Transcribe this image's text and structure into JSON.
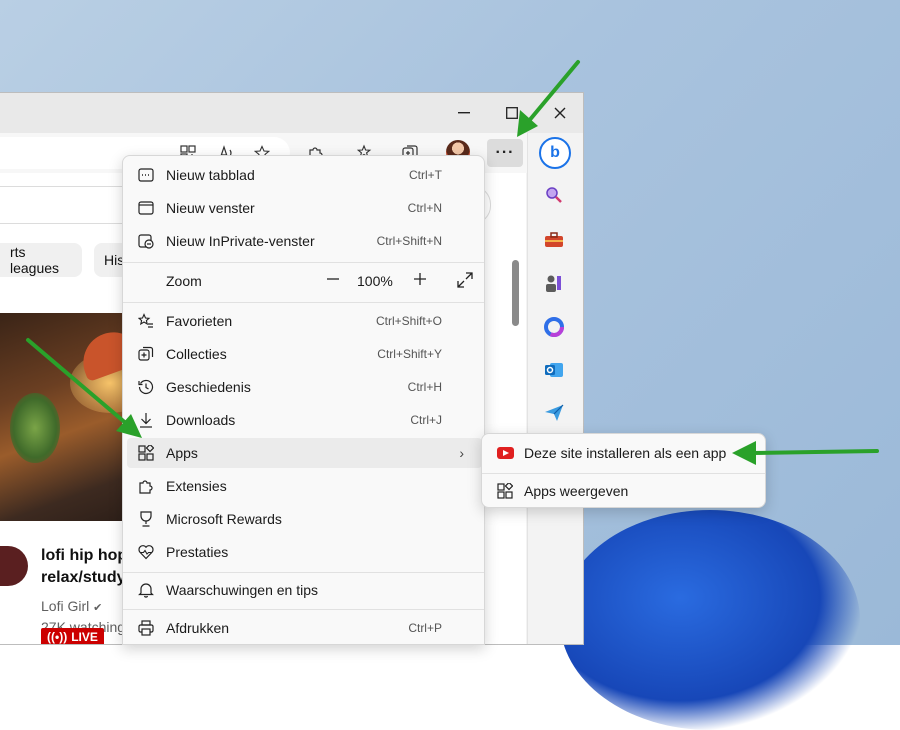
{
  "colors": {
    "accent_green": "#2aa12a",
    "live_red": "#cc0000",
    "menu_bg": "#f9f9f9",
    "highlight": "#ebebeb"
  },
  "window": {
    "controls": {
      "maximize": "☐",
      "close": "✕"
    }
  },
  "toolbar": {
    "more_label": "···",
    "icons": [
      "grid-icon",
      "read-aloud-icon",
      "favorite-star-icon",
      "extensions-icon",
      "favorites-list-icon",
      "collections-icon"
    ]
  },
  "page": {
    "chips": [
      "rts leagues",
      "His"
    ],
    "video": {
      "title": "lofi hip hop relax/study",
      "channel": "Lofi Girl",
      "verified": "✔",
      "watching": "27K watching",
      "live": "LIVE"
    }
  },
  "sidebar": {
    "icons": [
      "bing-icon",
      "search-icon",
      "toolbox-icon",
      "games-icon",
      "microsoft365-icon",
      "outlook-icon",
      "send-icon"
    ]
  },
  "menu": {
    "items": [
      {
        "label": "Nieuw tabblad",
        "shortcut": "Ctrl+T",
        "icon": "new-tab-icon"
      },
      {
        "label": "Nieuw venster",
        "shortcut": "Ctrl+N",
        "icon": "new-window-icon"
      },
      {
        "label": "Nieuw InPrivate-venster",
        "shortcut": "Ctrl+Shift+N",
        "icon": "inprivate-icon"
      }
    ],
    "zoom": {
      "label": "Zoom",
      "minus": "—",
      "value": "100%",
      "plus": "+",
      "expand": "⤢"
    },
    "items2": [
      {
        "label": "Favorieten",
        "shortcut": "Ctrl+Shift+O",
        "icon": "favorites-icon"
      },
      {
        "label": "Collecties",
        "shortcut": "Ctrl+Shift+Y",
        "icon": "collections-icon"
      },
      {
        "label": "Geschiedenis",
        "shortcut": "Ctrl+H",
        "icon": "history-icon"
      },
      {
        "label": "Downloads",
        "shortcut": "Ctrl+J",
        "icon": "download-icon"
      },
      {
        "label": "Apps",
        "shortcut": "›",
        "icon": "apps-icon"
      },
      {
        "label": "Extensies",
        "shortcut": "",
        "icon": "extensions-icon"
      },
      {
        "label": "Microsoft Rewards",
        "shortcut": "",
        "icon": "rewards-icon"
      },
      {
        "label": "Prestaties",
        "shortcut": "",
        "icon": "performance-icon"
      }
    ],
    "items3": [
      {
        "label": "Waarschuwingen en tips",
        "shortcut": "",
        "icon": "bell-icon"
      },
      {
        "label": "Afdrukken",
        "shortcut": "Ctrl+P",
        "icon": "print-icon"
      }
    ]
  },
  "submenu": {
    "items": [
      {
        "label": "Deze site installeren als een app",
        "icon": "youtube-icon"
      },
      {
        "label": "Apps weergeven",
        "icon": "apps-icon"
      }
    ]
  }
}
